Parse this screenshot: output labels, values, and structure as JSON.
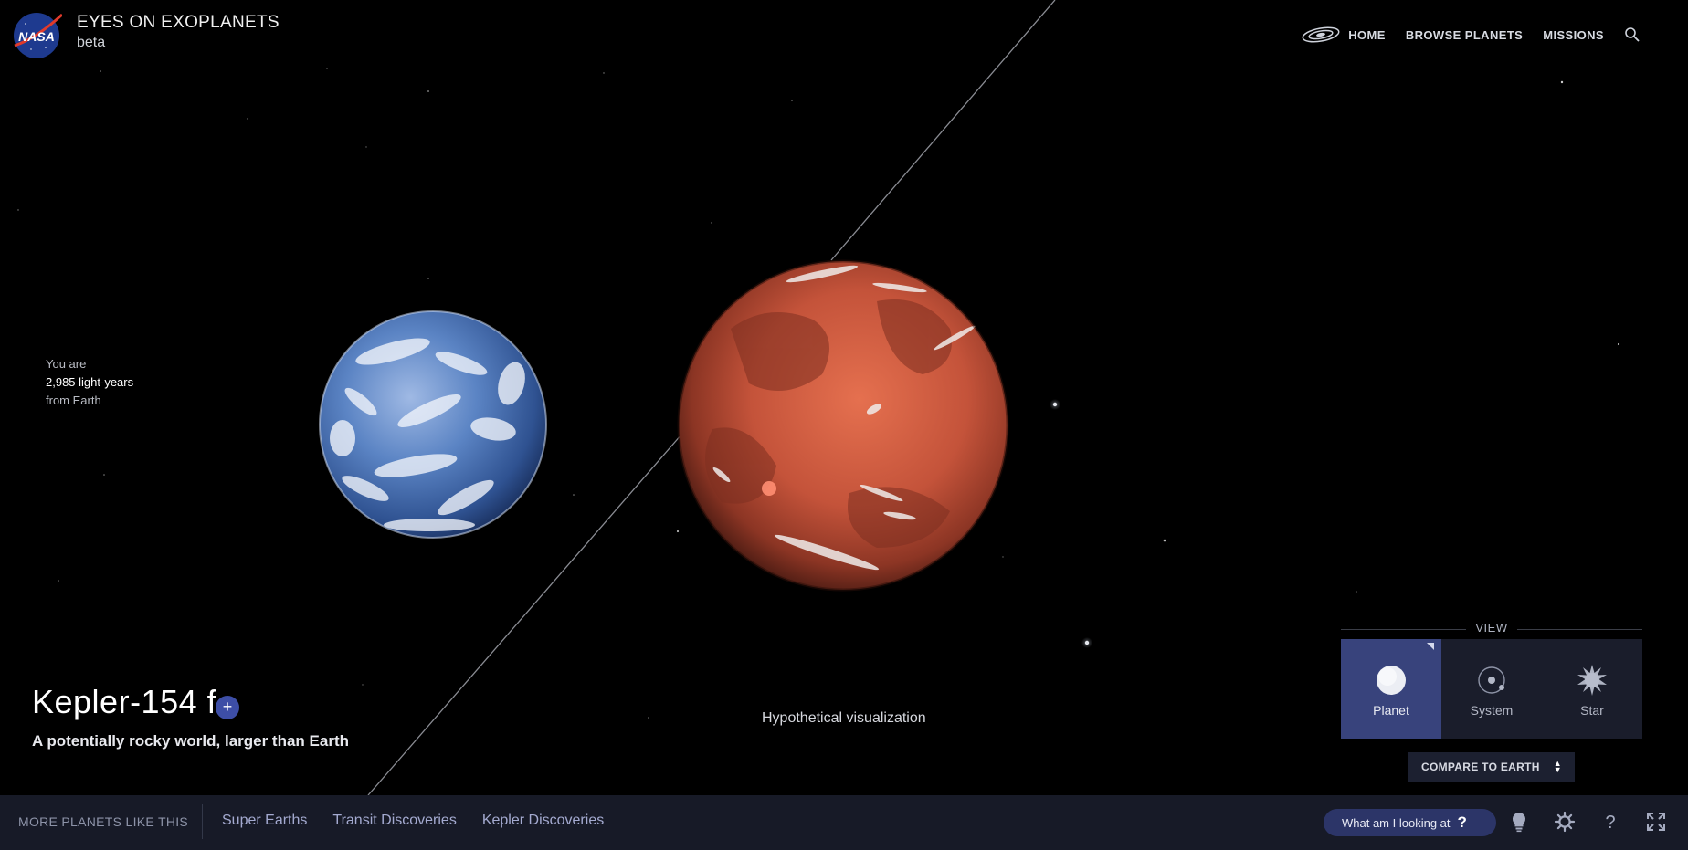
{
  "header": {
    "logo_text": "NASA",
    "title": "EYES ON EXOPLANETS",
    "subtitle": "beta",
    "nav": [
      {
        "label": "HOME",
        "icon": "galaxy-icon"
      },
      {
        "label": "BROWSE PLANETS"
      },
      {
        "label": "MISSIONS"
      }
    ],
    "search_icon": "search-icon"
  },
  "distance": {
    "line1": "You are",
    "line2": "2,985 light-years",
    "line3": "from Earth"
  },
  "planet": {
    "name": "Kepler-154 f",
    "add_label": "+",
    "tagline": "A potentially rocky world, larger than Earth",
    "caption": "Hypothetical visualization"
  },
  "view": {
    "label": "VIEW",
    "buttons": [
      {
        "label": "Planet",
        "icon": "planet-icon",
        "active": true
      },
      {
        "label": "System",
        "icon": "system-icon",
        "active": false
      },
      {
        "label": "Star",
        "icon": "star-icon",
        "active": false
      }
    ],
    "compare_label": "COMPARE TO EARTH"
  },
  "footer": {
    "more_label": "MORE PLANETS LIKE THIS",
    "links": [
      "Super Earths",
      "Transit Discoveries",
      "Kepler Discoveries"
    ],
    "what_label": "What am I looking at",
    "what_q": "?",
    "icons": [
      "lightbulb-icon",
      "settings-icon",
      "help-icon",
      "fullscreen-icon"
    ]
  },
  "colors": {
    "background": "#000000",
    "footer_bg": "#171a27",
    "accent": "#3d4ea6",
    "planet_red": "#c9573a",
    "earth_blue": "#4f78b8"
  }
}
